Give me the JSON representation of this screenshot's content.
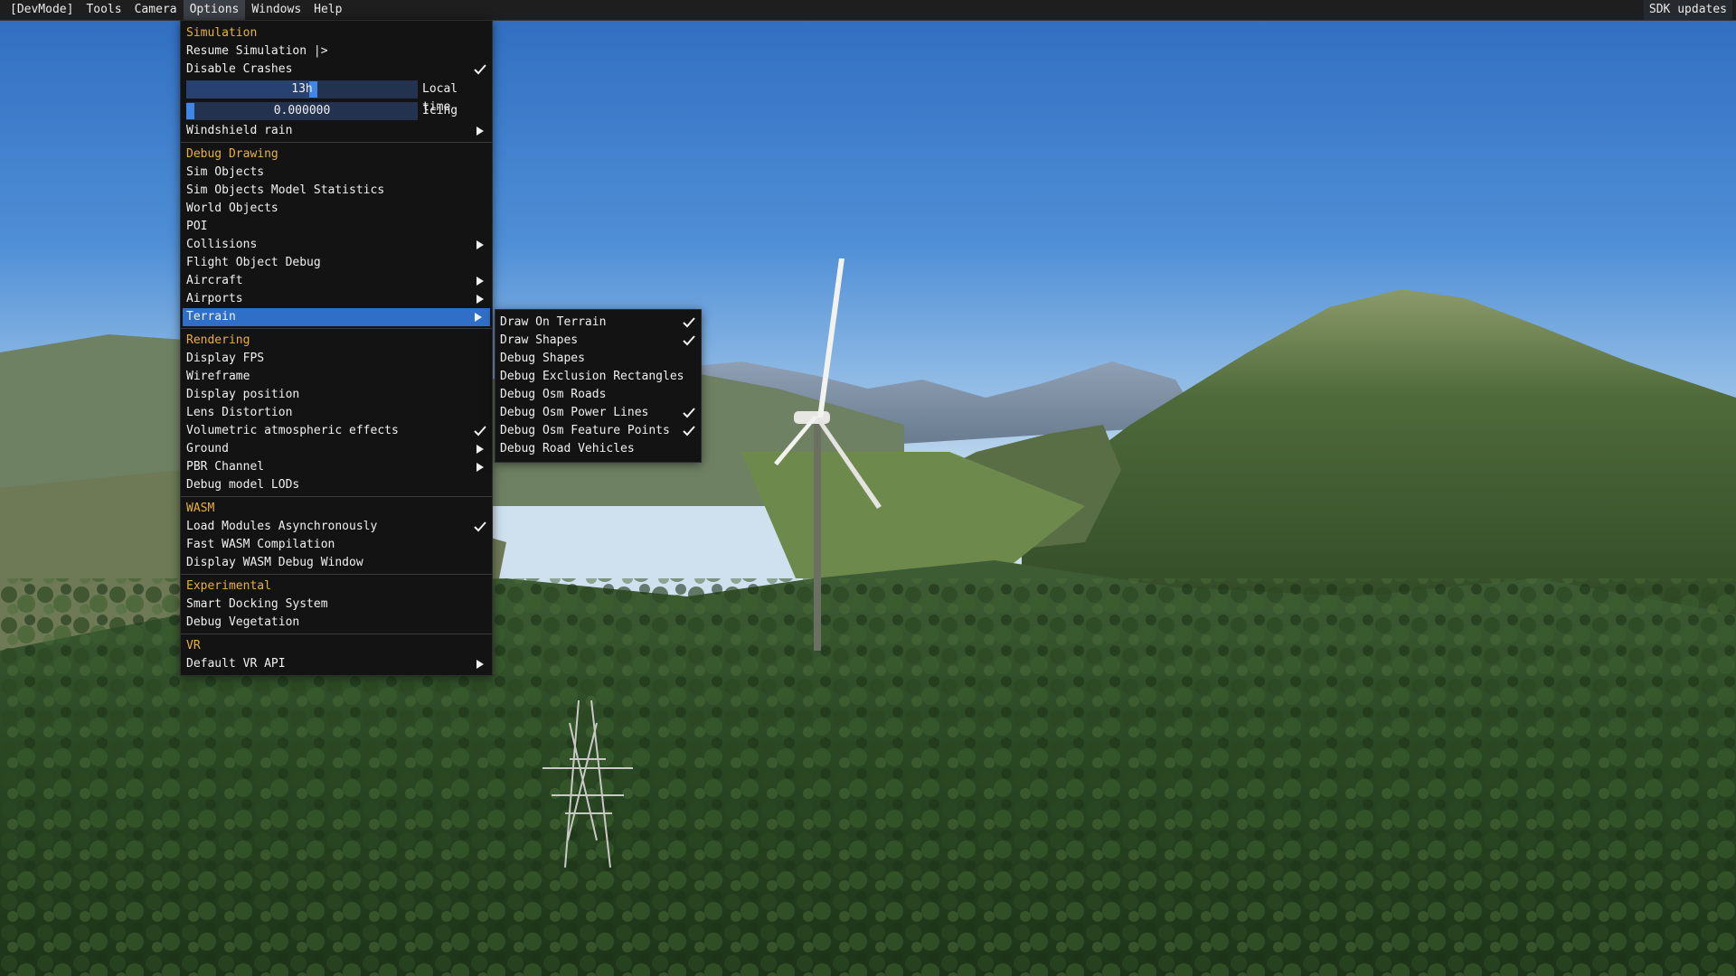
{
  "menubar": {
    "items": [
      "[DevMode]",
      "Tools",
      "Camera",
      "Options",
      "Windows",
      "Help"
    ],
    "active": "Options",
    "right_label": "SDK updates"
  },
  "options_menu": {
    "simulation": {
      "header": "Simulation",
      "resume": "Resume Simulation |>",
      "disable_crashes": "Disable Crashes",
      "local_time": {
        "value": "13h",
        "label": "Local time",
        "fraction": 0.55
      },
      "icing": {
        "value": "0.000000",
        "label": "Icing",
        "fraction": 0.0
      },
      "windshield_rain": "Windshield rain"
    },
    "debug_drawing": {
      "header": "Debug Drawing",
      "items": [
        "Sim Objects",
        "Sim Objects Model Statistics",
        "World Objects",
        "POI",
        "Collisions",
        "Flight Object Debug",
        "Aircraft",
        "Airports",
        "Terrain"
      ]
    },
    "rendering": {
      "header": "Rendering",
      "items": [
        "Display FPS",
        "Wireframe",
        "Display position",
        "Lens Distortion",
        "Volumetric atmospheric effects",
        "Ground",
        "PBR Channel",
        "Debug model LODs"
      ]
    },
    "wasm": {
      "header": "WASM",
      "items": [
        "Load Modules Asynchronously",
        "Fast WASM Compilation",
        "Display WASM Debug Window"
      ]
    },
    "experimental": {
      "header": "Experimental",
      "items": [
        "Smart Docking System",
        "Debug Vegetation"
      ]
    },
    "vr": {
      "header": "VR",
      "items": [
        "Default VR API"
      ]
    }
  },
  "terrain_menu": {
    "items": [
      "Draw On Terrain",
      "Draw Shapes",
      "Debug Shapes",
      "Debug Exclusion Rectangles",
      "Debug Osm Roads",
      "Debug Osm Power Lines",
      "Debug Osm Feature Points",
      "Debug Road Vehicles"
    ]
  },
  "colors": {
    "section_header": "#e8b13a",
    "selected_bg": "#2f6fc7",
    "menu_bg": "#131313",
    "menubar_bg": "#1e1e1e"
  }
}
